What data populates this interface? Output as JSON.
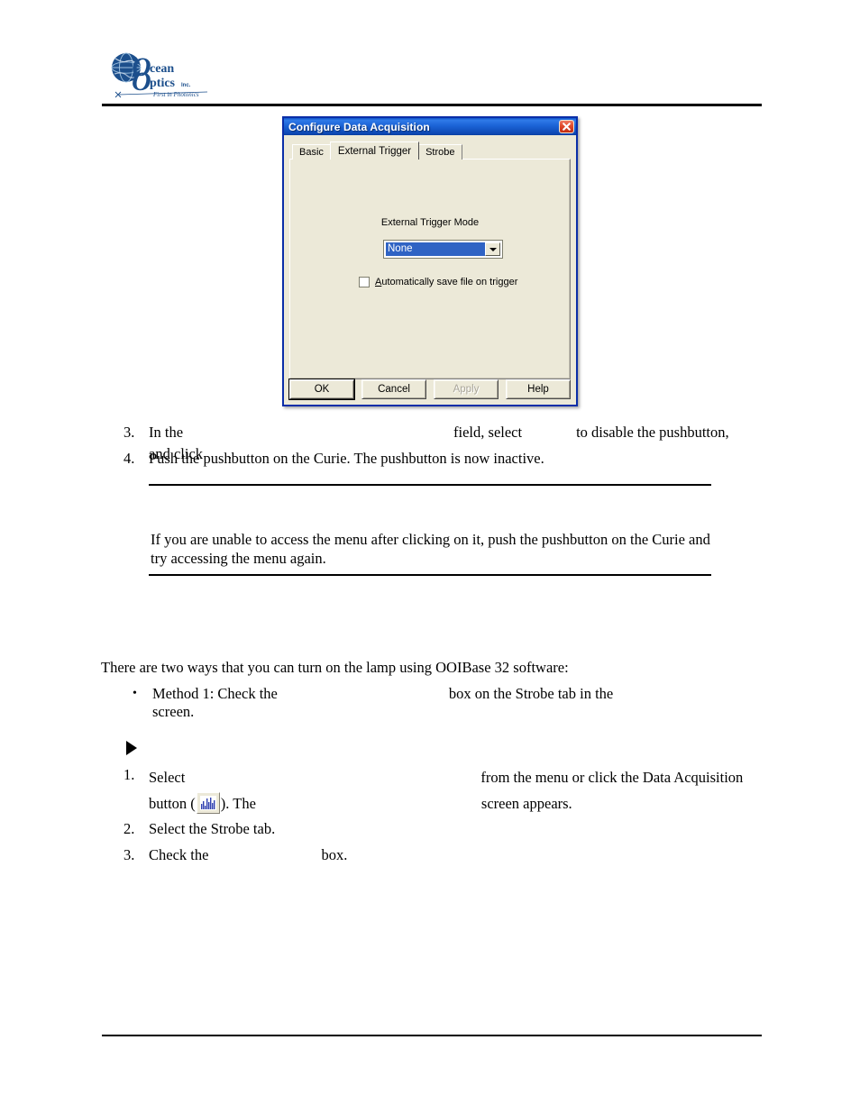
{
  "page": {
    "logo_alt": "Ocean Optics Inc. - First in Photonics"
  },
  "dialog": {
    "title": "Configure Data Acquisition",
    "close_icon": "close-icon",
    "tabs": [
      {
        "label": "Basic",
        "active": false
      },
      {
        "label": "External Trigger",
        "active": true
      },
      {
        "label": "Strobe",
        "active": false
      }
    ],
    "trigger_mode_label": "External Trigger Mode",
    "trigger_mode_value": "None",
    "trigger_mode_arrow_icon": "chevron-down-icon",
    "autosave_checkbox_label_accesskey": "A",
    "autosave_checkbox_label_rest": "utomatically save file on trigger",
    "autosave_checked": false,
    "buttons": {
      "ok": "OK",
      "cancel": "Cancel",
      "apply": "Apply",
      "help": "Help"
    },
    "colors": {
      "titlebar_blue": "#1b63d6",
      "dialog_face": "#ece9d8",
      "selection_blue": "#2f63c4",
      "close_red": "#e04a2a",
      "border_blue": "#0a2ea8"
    }
  },
  "steps_upper": [
    {
      "number": "3.",
      "part1": "In the",
      "part2": "field, select",
      "part3": "to disable the pushbutton, and click",
      "part4": "."
    },
    {
      "number": "4.",
      "part1": "Push the pushbutton on the Curie. The pushbutton is now inactive."
    }
  ],
  "note": {
    "text": "If you are unable to access the menu after clicking on it, push the pushbutton on the Curie and try accessing the menu again."
  },
  "intro_paragraph": "There are two ways that you can turn on the lamp using OOIBase 32 software:",
  "bullets": [
    {
      "marker": "•",
      "part1": "Method 1: Check the",
      "part2": "box on the Strobe tab in the",
      "part3": "screen."
    }
  ],
  "triangle_marker_icon": "triangle-right-icon",
  "steps_lower": [
    {
      "number": "1.",
      "part1": "Select",
      "part2": "from the menu or click the Data Acquisition",
      "part3": "button (",
      "part4": "). The",
      "part5": "screen appears."
    },
    {
      "number": "2.",
      "part1": "Select the Strobe tab."
    },
    {
      "number": "3.",
      "part1": "Check the",
      "part2": "box."
    }
  ],
  "data_acquisition_icon": "spectrum-chart-icon"
}
